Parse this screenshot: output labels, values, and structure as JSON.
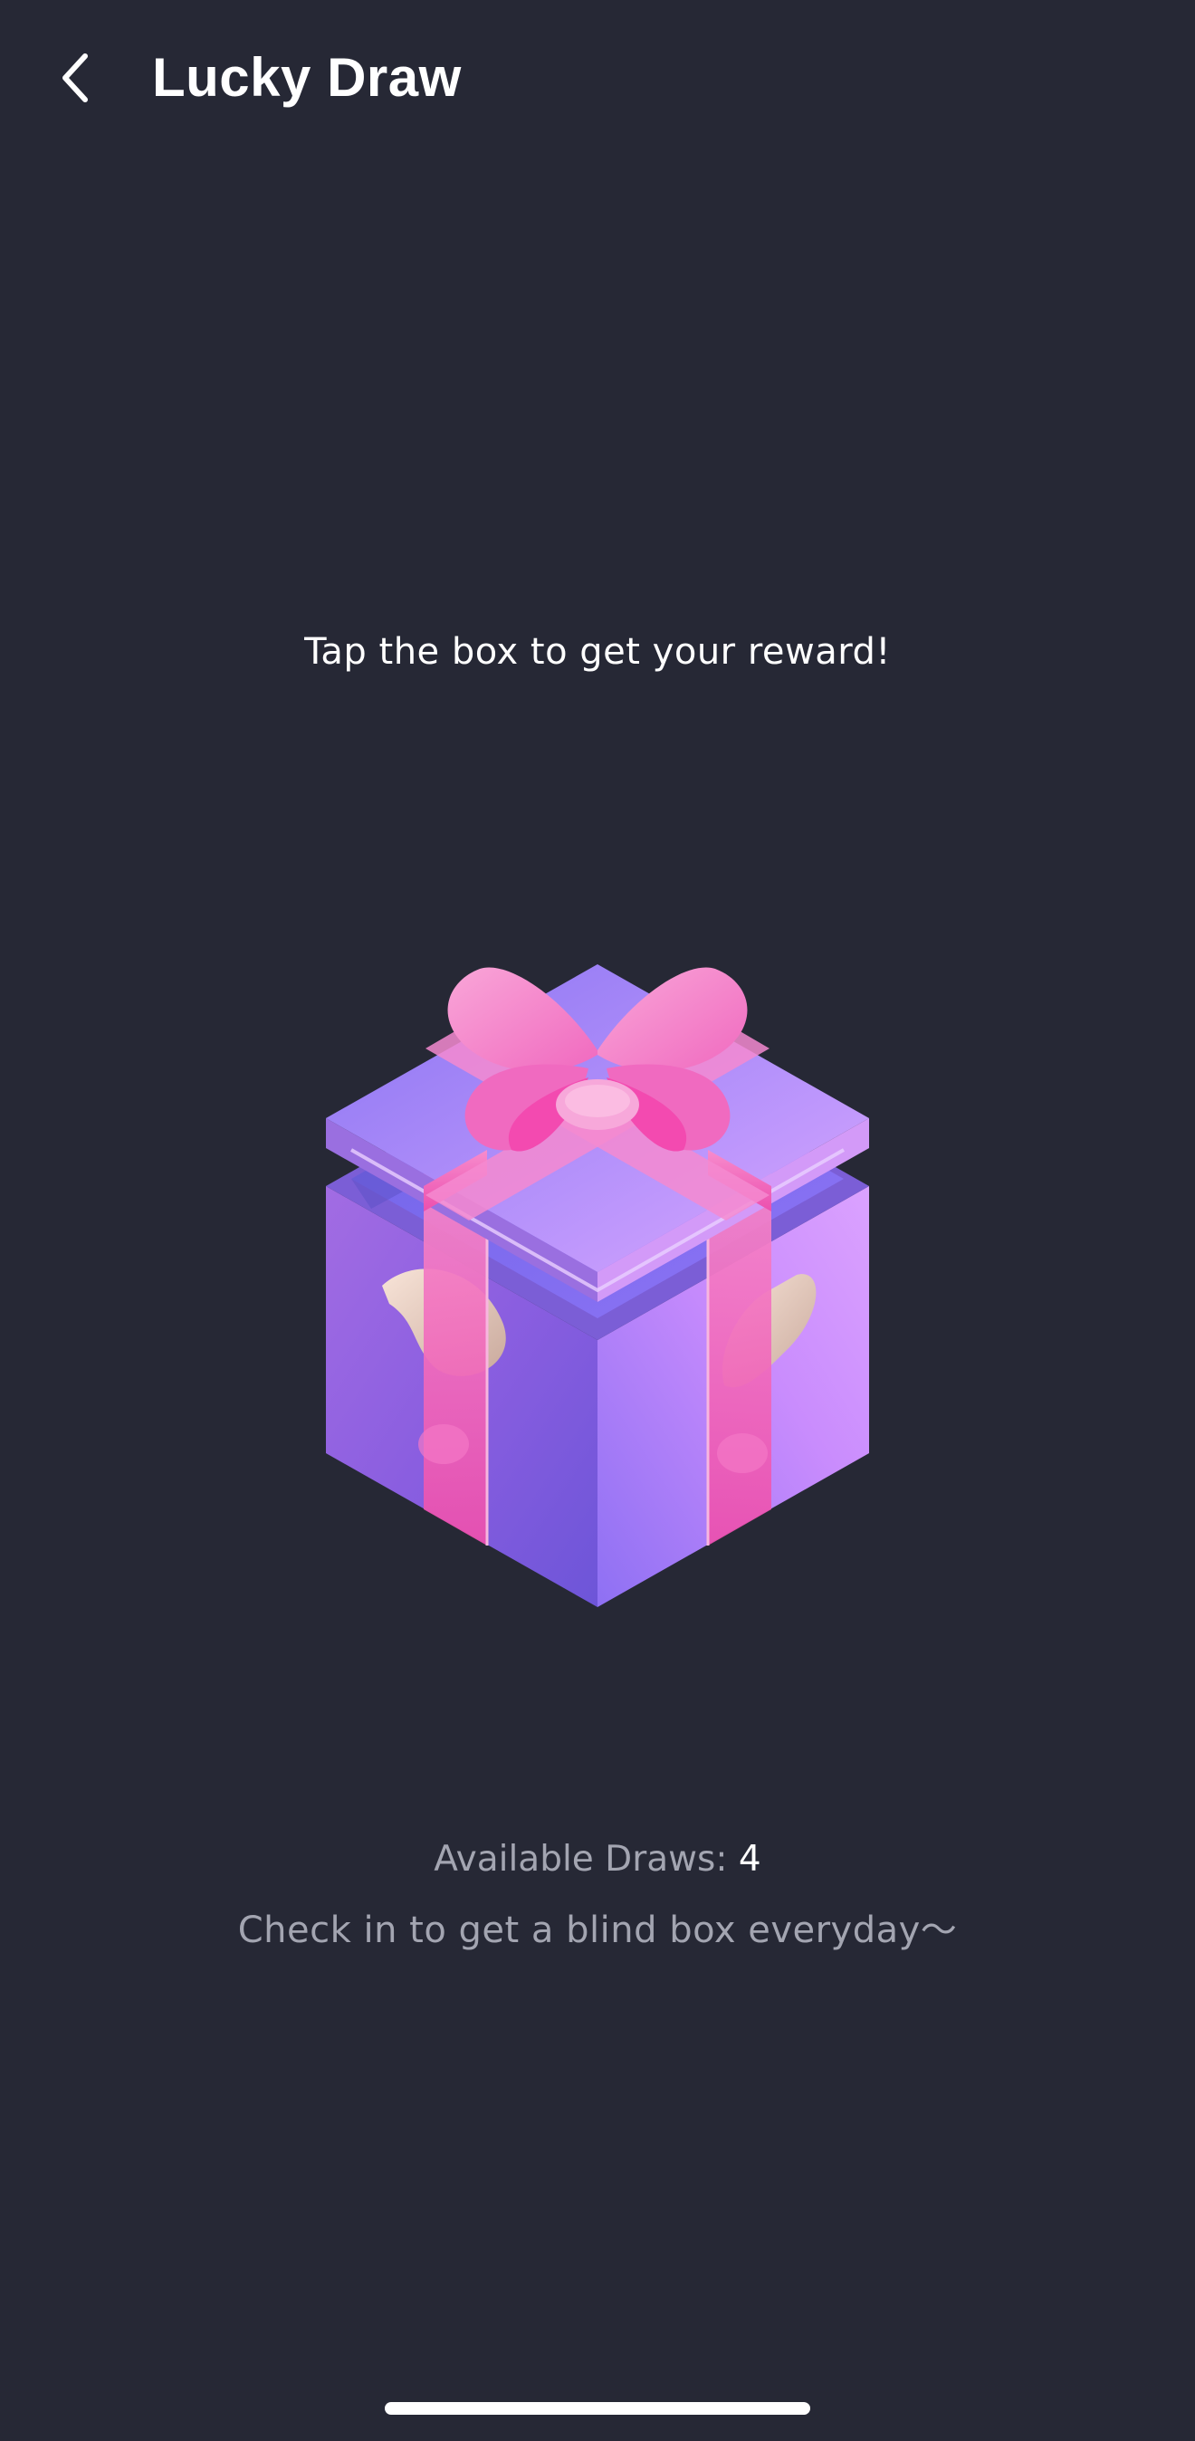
{
  "header": {
    "title": "Lucky Draw",
    "back_icon": "chevron-left-icon"
  },
  "main": {
    "instruction": "Tap the box to get your reward!",
    "gift_icon": "gift-box-icon",
    "draws_label": "Available Draws:",
    "draws_count": "4",
    "checkin_text": "Check in to get a blind box everyday～"
  },
  "colors": {
    "background": "#262835",
    "box_purple": "#8b6cf0",
    "box_light_purple": "#d99bff",
    "ribbon_pink": "#f25cb5",
    "secondary_text": "#a3a5b1"
  }
}
